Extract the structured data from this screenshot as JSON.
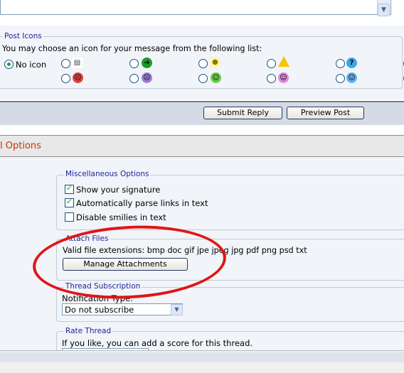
{
  "post_icons": {
    "legend": "Post Icons",
    "instruction": "You may choose an icon for your message from the following list:",
    "no_icon_label": "No icon",
    "icons": [
      {
        "name": "document-icon",
        "glyph": "📄"
      },
      {
        "name": "arrow-right-icon",
        "glyph": "➔"
      },
      {
        "name": "lightbulb-icon",
        "glyph": "💡"
      },
      {
        "name": "warning-icon",
        "glyph": "⚠"
      },
      {
        "name": "question-icon",
        "glyph": "?"
      },
      {
        "name": "angry-face-icon",
        "glyph": "☹"
      },
      {
        "name": "frown-face-icon",
        "glyph": "☹"
      },
      {
        "name": "grin-face-icon",
        "glyph": "☺"
      },
      {
        "name": "smile-face-icon",
        "glyph": "☺"
      },
      {
        "name": "wink-face-icon",
        "glyph": "☺"
      }
    ]
  },
  "buttons": {
    "submit_reply": "Submit Reply",
    "preview_post": "Preview Post"
  },
  "options": {
    "title": "l Options",
    "misc": {
      "legend": "Miscellaneous Options",
      "show_signature": "Show your signature",
      "parse_links": "Automatically parse links in text",
      "disable_smilies": "Disable smilies in text"
    },
    "attach": {
      "legend": "Attach Files",
      "extensions": "Valid file extensions: bmp doc gif jpe jpeg jpg pdf png psd txt",
      "manage_button": "Manage Attachments"
    },
    "subscription": {
      "legend": "Thread Subscription",
      "notification_label": "Notification Type:",
      "selected": "Do not subscribe"
    },
    "rate": {
      "legend": "Rate Thread",
      "text": "If you like, you can add a score for this thread."
    }
  },
  "colors": {
    "legend": "#22229c",
    "section_title": "#cc3300",
    "annotation_circle": "#e01515"
  }
}
